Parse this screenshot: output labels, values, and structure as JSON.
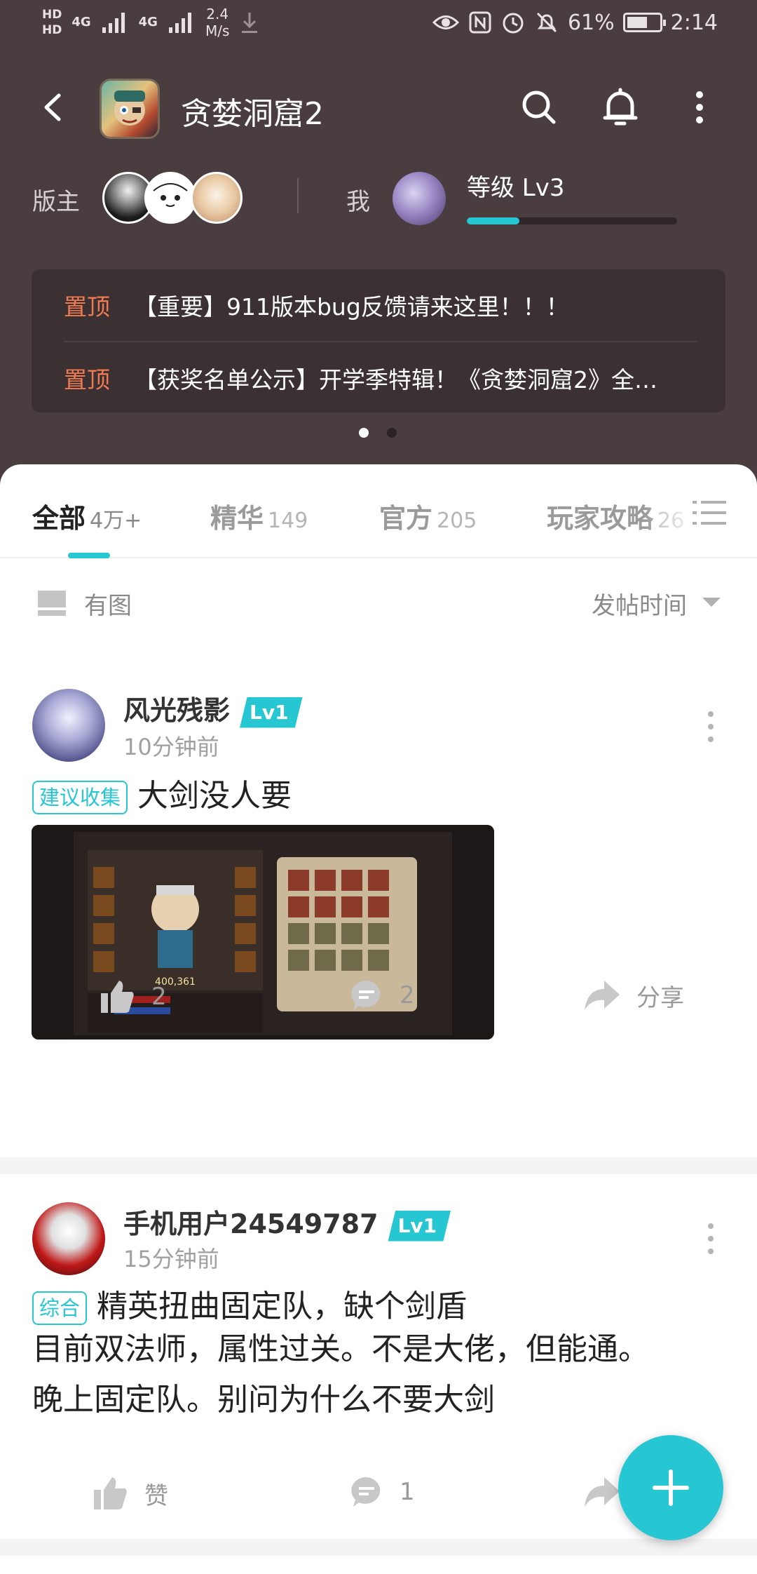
{
  "status_bar": {
    "hd1": "HD",
    "hd2": "HD",
    "network1": "4G",
    "network2": "4G",
    "speed_value": "2.4",
    "speed_unit": "M/s",
    "battery": "61%",
    "time": "2:14"
  },
  "header": {
    "title": "贪婪洞窟2",
    "moderator_label": "版主",
    "me_label": "我",
    "level_text": "等级 Lv3",
    "level_progress": 0.25
  },
  "pinned": [
    {
      "tag": "置顶",
      "text": "【重要】911版本bug反馈请来这里！！！"
    },
    {
      "tag": "置顶",
      "text": "【获奖名单公示】开学季特辑！《贪婪洞窟2》全…"
    }
  ],
  "tabs": [
    {
      "label": "全部",
      "count": "4万+"
    },
    {
      "label": "精华",
      "count": "149"
    },
    {
      "label": "官方",
      "count": "205"
    },
    {
      "label": "玩家攻略",
      "count": "26"
    }
  ],
  "filter": {
    "image_label": "有图",
    "sort_label": "发帖时间"
  },
  "posts": [
    {
      "author": "风光残影",
      "level": "Lv1",
      "time": "10分钟前",
      "tag": "建议收集",
      "title": "大剑没人要",
      "likes": "2",
      "comments": "2",
      "share": "分享",
      "image_power": "400,361"
    },
    {
      "author": "手机用户24549787",
      "level": "Lv1",
      "time": "15分钟前",
      "tag": "综合",
      "title": "精英扭曲固定队，缺个剑盾",
      "body_line1": "目前双法师，属性过关。不是大佬，但能通。",
      "body_line2": "晚上固定队。别问为什么不要大剑",
      "likes": "赞",
      "comments": "1"
    }
  ],
  "colors": {
    "header_bg": "#4a3d3f",
    "accent": "#27c6d3",
    "pinned_tag": "#f07a52"
  },
  "icons": {
    "back": "back-arrow-icon",
    "search": "search-icon",
    "bell": "bell-icon",
    "more": "more-vertical-icon",
    "like": "thumb-up-icon",
    "comment": "comment-icon",
    "share": "share-icon",
    "add": "plus-icon"
  }
}
